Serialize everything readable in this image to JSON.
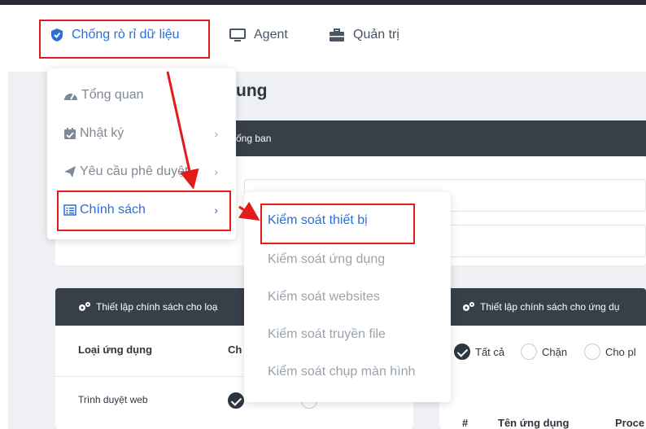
{
  "navbar": {
    "items": [
      {
        "label": "Chống rò rỉ dữ liệu",
        "icon": "shield-icon",
        "active": true
      },
      {
        "label": "Agent",
        "icon": "monitor-icon"
      },
      {
        "label": "Quản trị",
        "icon": "briefcase-icon"
      }
    ]
  },
  "page": {
    "title": "ung",
    "bar_text": "ống ban"
  },
  "dropdown": {
    "items": [
      {
        "label": "Tổng quan",
        "icon": "dashboard-icon"
      },
      {
        "label": "Nhật ký",
        "icon": "calendar-check-icon"
      },
      {
        "label": "Yêu cầu phê duyệt",
        "icon": "send-icon"
      },
      {
        "label": "Chính sách",
        "icon": "list-icon",
        "active": true
      }
    ]
  },
  "submenu": {
    "items": [
      {
        "label": "Kiểm soát thiết bị",
        "active": true
      },
      {
        "label": "Kiểm soát ứng dụng"
      },
      {
        "label": "Kiểm soát websites"
      },
      {
        "label": "Kiểm soát truyền file"
      },
      {
        "label": "Kiểm soát chụp màn hình"
      }
    ]
  },
  "left_panel": {
    "title": "Thiết lập chính sách cho loạ",
    "col_app_type": "Loại ứng dụng",
    "col_second": "Ch",
    "row1": "Trình duyệt web"
  },
  "right_panel": {
    "title": "Thiết lập chính sách cho ứng dụ",
    "radios": [
      "Tất cả",
      "Chặn",
      "Cho pl"
    ],
    "col_num": "#",
    "col_app_name": "Tên ứng dụng",
    "col_process": "Proce"
  },
  "colors": {
    "accent": "#2b6fd6",
    "dark_header": "#373f49",
    "highlight": "#e41b1b"
  }
}
